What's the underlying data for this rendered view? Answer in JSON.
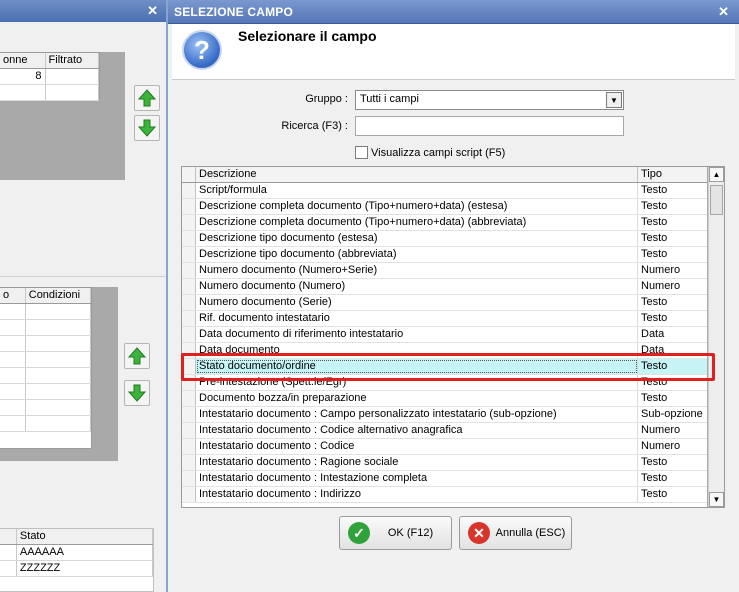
{
  "background": {
    "close_glyph": "✕",
    "top_table": {
      "headers": [
        "onne",
        "Filtrato"
      ],
      "rows": [
        [
          "8",
          ""
        ],
        [
          "",
          ""
        ]
      ]
    },
    "mid_table": {
      "headers": [
        "o",
        "Condizioni"
      ],
      "rows_count": 8
    },
    "bottom_table": {
      "headers": [
        "",
        "Stato"
      ],
      "rows": [
        [
          "",
          "AAAAAA"
        ],
        [
          "",
          "ZZZZZZ"
        ]
      ]
    }
  },
  "dialog": {
    "title": "SELEZIONE CAMPO",
    "close_glyph": "✕",
    "heading": "Selezionare il campo",
    "help_glyph": "?",
    "gruppo_label": "Gruppo :",
    "gruppo_value": "Tutti i campi",
    "ricerca_label": "Ricerca (F3) :",
    "ricerca_value": "",
    "checkbox_label": "Visualizza campi script (F5)",
    "grid": {
      "col_desc": "Descrizione",
      "col_tipo": "Tipo",
      "rows": [
        {
          "desc": "Script/formula",
          "tipo": "Testo"
        },
        {
          "desc": "Descrizione completa documento (Tipo+numero+data) (estesa)",
          "tipo": "Testo"
        },
        {
          "desc": "Descrizione completa documento (Tipo+numero+data) (abbreviata)",
          "tipo": "Testo"
        },
        {
          "desc": "Descrizione tipo documento (estesa)",
          "tipo": "Testo"
        },
        {
          "desc": "Descrizione tipo documento (abbreviata)",
          "tipo": "Testo"
        },
        {
          "desc": "Numero documento (Numero+Serie)",
          "tipo": "Numero"
        },
        {
          "desc": "Numero documento (Numero)",
          "tipo": "Numero"
        },
        {
          "desc": "Numero documento (Serie)",
          "tipo": "Testo"
        },
        {
          "desc": "Rif. documento intestatario",
          "tipo": "Testo"
        },
        {
          "desc": "Data documento di riferimento intestatario",
          "tipo": "Data"
        },
        {
          "desc": "Data documento",
          "tipo": "Data"
        },
        {
          "desc": "Stato documento/ordine",
          "tipo": "Testo",
          "selected": true
        },
        {
          "desc": "Pre-intestazione (Spett.le/Egr)",
          "tipo": "Testo"
        },
        {
          "desc": "Documento bozza/in preparazione",
          "tipo": "Testo"
        },
        {
          "desc": "Intestatario documento : Campo personalizzato intestatario (sub-opzione)",
          "tipo": "Sub-opzione"
        },
        {
          "desc": "Intestatario documento : Codice alternativo anagrafica",
          "tipo": "Numero"
        },
        {
          "desc": "Intestatario documento : Codice",
          "tipo": "Numero"
        },
        {
          "desc": "Intestatario documento : Ragione sociale",
          "tipo": "Testo"
        },
        {
          "desc": "Intestatario documento : Intestazione completa",
          "tipo": "Testo"
        },
        {
          "desc": "Intestatario documento : Indirizzo",
          "tipo": "Testo"
        }
      ]
    },
    "ok_label": "OK (F12)",
    "cancel_label": "Annulla (ESC)"
  }
}
